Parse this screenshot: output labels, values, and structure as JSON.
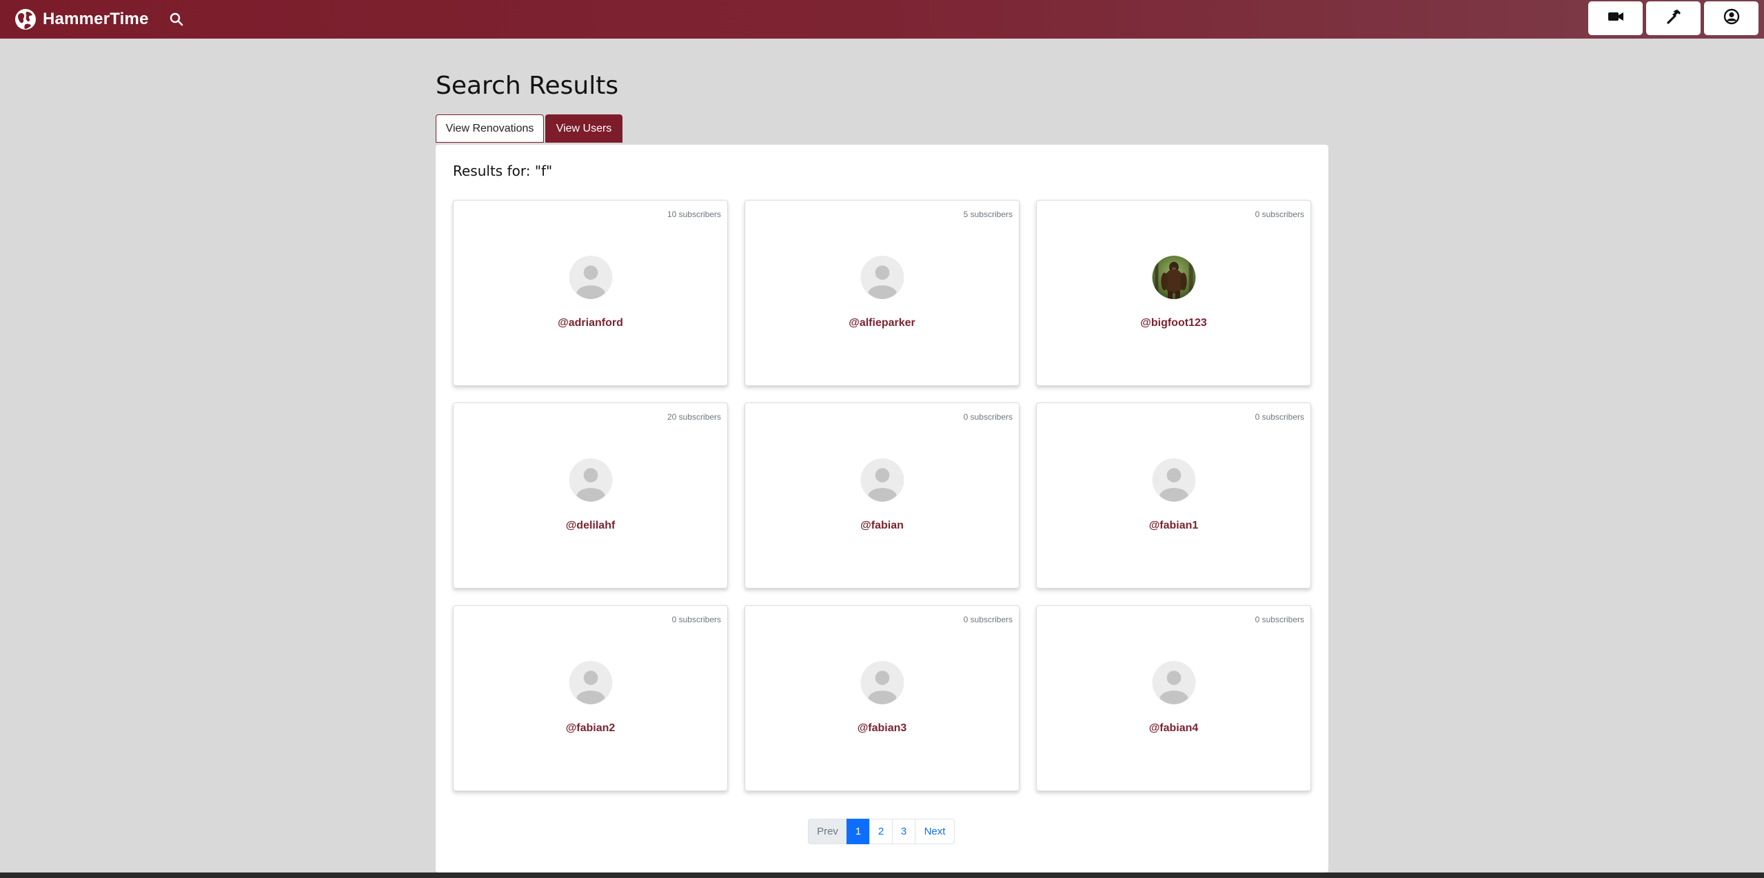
{
  "brand": {
    "name": "HammerTime",
    "logo_icon": "globe-logo-icon"
  },
  "nav": {
    "search_icon": "search-icon",
    "buttons": [
      {
        "icon": "video-camera-icon"
      },
      {
        "icon": "hammer-icon"
      },
      {
        "icon": "user-circle-icon"
      }
    ]
  },
  "page": {
    "title": "Search Results"
  },
  "tabs": {
    "renovations": "View Renovations",
    "users": "View Users",
    "active": "users"
  },
  "results": {
    "label": "Results for: \"f\""
  },
  "users": [
    {
      "username": "@adrianford",
      "subscribers": "10 subscribers",
      "avatar": "default-avatar"
    },
    {
      "username": "@alfieparker",
      "subscribers": "5 subscribers",
      "avatar": "default-avatar"
    },
    {
      "username": "@bigfoot123",
      "subscribers": "0 subscribers",
      "avatar": "bigfoot-photo"
    },
    {
      "username": "@delilahf",
      "subscribers": "20 subscribers",
      "avatar": "default-avatar"
    },
    {
      "username": "@fabian",
      "subscribers": "0 subscribers",
      "avatar": "default-avatar"
    },
    {
      "username": "@fabian1",
      "subscribers": "0 subscribers",
      "avatar": "default-avatar"
    },
    {
      "username": "@fabian2",
      "subscribers": "0 subscribers",
      "avatar": "default-avatar"
    },
    {
      "username": "@fabian3",
      "subscribers": "0 subscribers",
      "avatar": "default-avatar"
    },
    {
      "username": "@fabian4",
      "subscribers": "0 subscribers",
      "avatar": "default-avatar"
    }
  ],
  "pagination": {
    "prev": "Prev",
    "pages": [
      "1",
      "2",
      "3"
    ],
    "current": "1",
    "next": "Next"
  },
  "colors": {
    "brand": "#7b1c2a",
    "username": "#7a2430",
    "active_page": "#0d6efd",
    "background": "#d9d9d9"
  }
}
